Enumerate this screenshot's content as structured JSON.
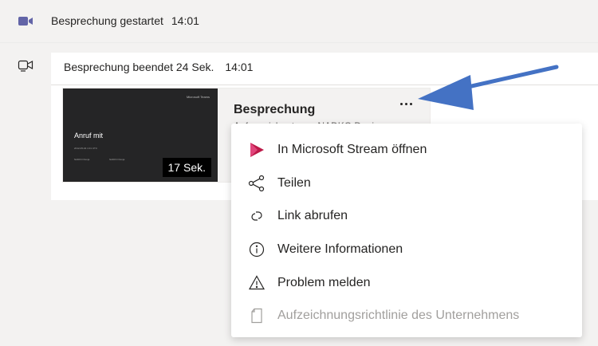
{
  "timeline": {
    "started": {
      "label": "Besprechung gestartet",
      "time": "14:01"
    },
    "ended": {
      "label": "Besprechung beendet",
      "duration": "24 Sek.",
      "time": "14:01"
    }
  },
  "recording": {
    "thumbnail": {
      "brand": "Microsoft Teams",
      "title": "Anruf mit",
      "date": "2012-05-04 1:01 UTC",
      "org1": "NADKO Dunja",
      "org2": "NADKO Dunja",
      "duration": "17 Sek."
    },
    "title": "Besprechung",
    "subtitle": "Aufgezeichnet von: NADKO Dunja"
  },
  "menu": {
    "items": [
      {
        "label": "In Microsoft Stream öffnen",
        "icon": "stream-icon",
        "disabled": false
      },
      {
        "label": "Teilen",
        "icon": "share-icon",
        "disabled": false
      },
      {
        "label": "Link abrufen",
        "icon": "link-icon",
        "disabled": false
      },
      {
        "label": "Weitere Informationen",
        "icon": "info-icon",
        "disabled": false
      },
      {
        "label": "Problem melden",
        "icon": "warning-icon",
        "disabled": false
      },
      {
        "label": "Aufzeichnungsrichtlinie des Unternehmens",
        "icon": "document-icon",
        "disabled": true
      }
    ]
  },
  "colors": {
    "teams_purple": "#6264a7",
    "stream_red": "#bc1948",
    "annotation_arrow": "#4472c4"
  }
}
